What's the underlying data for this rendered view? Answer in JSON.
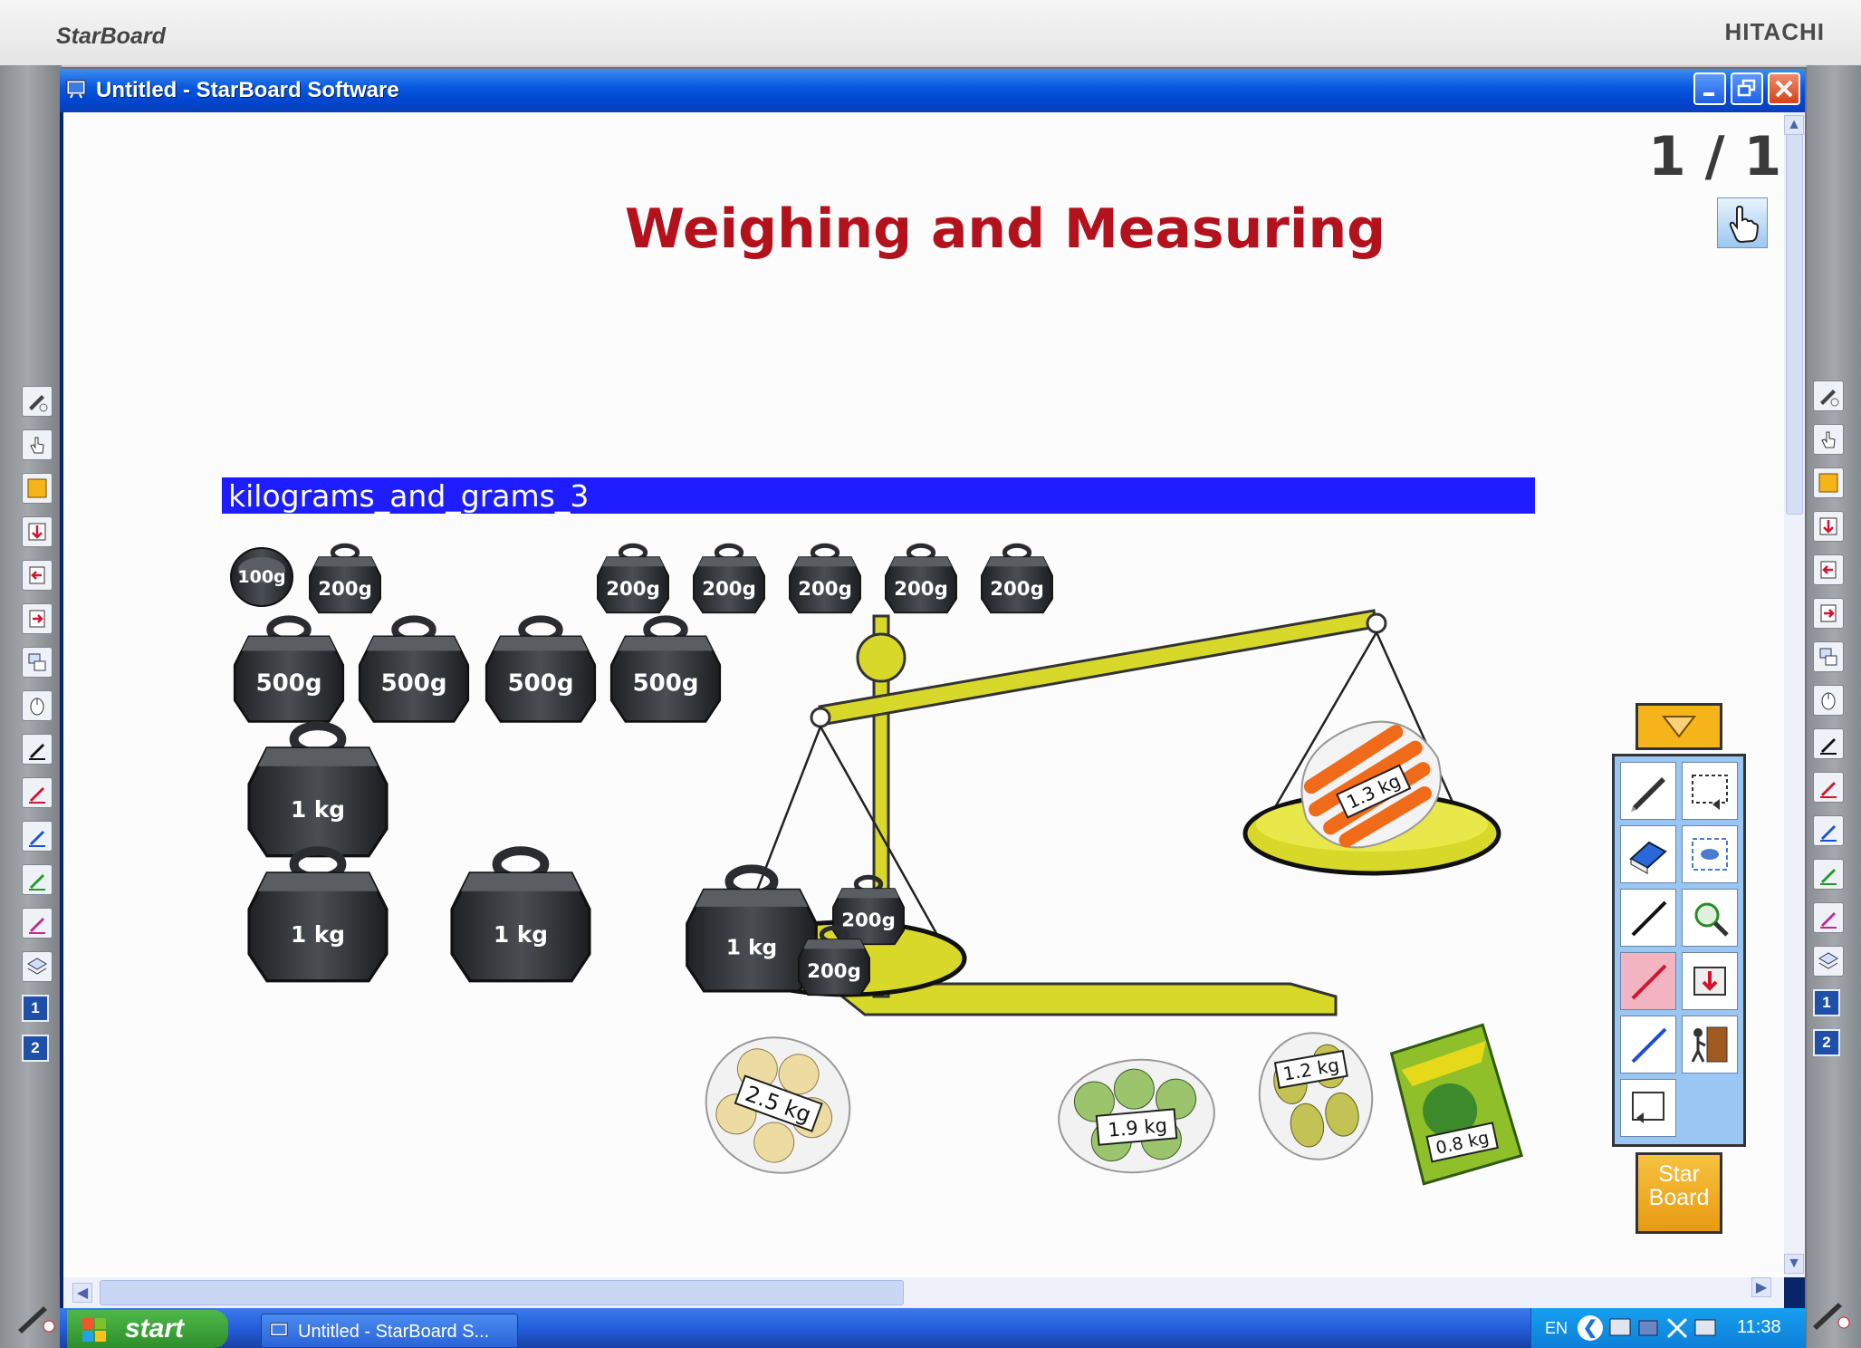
{
  "bezel": {
    "brand": "StarBoard",
    "maker": "HITACHI"
  },
  "window": {
    "title": "Untitled - StarBoard Software"
  },
  "page": {
    "indicator": "1 / 1"
  },
  "slide": {
    "title": "Weighing and Measuring",
    "flash_title": "kilograms_and_grams_3"
  },
  "weights": {
    "loose": [
      "100g",
      "200g",
      "200g",
      "200g",
      "200g",
      "200g",
      "200g",
      "500g",
      "500g",
      "500g",
      "500g",
      "1 kg",
      "1 kg",
      "1 kg"
    ],
    "on_scale": [
      "1 kg",
      "200g",
      "200g"
    ]
  },
  "produce": {
    "on_scale": "1.3 kg",
    "items": [
      "2.5 kg",
      "1.9 kg",
      "1.2 kg",
      "0.8 kg"
    ]
  },
  "toolbar": {
    "logo_line1": "Star",
    "logo_line2": "Board"
  },
  "side_toolbar": {
    "page1": "1",
    "page2": "2"
  },
  "taskbar": {
    "start": "start",
    "task": "Untitled - StarBoard S...",
    "lang": "EN",
    "clock": "11:38"
  },
  "colors": {
    "title_red": "#b3111c",
    "flash_bar": "#1d1dff",
    "scale_yellow": "#d8d82a",
    "weight_dark": "#2f3236",
    "xp_blue": "#0a5be0",
    "toolbar_orange": "#f5b51a"
  },
  "icons": {
    "side": [
      "pen-mode-icon",
      "mouse-mode-icon",
      "starboard-app-icon",
      "import-icon",
      "previous-page-icon",
      "next-page-icon",
      "page-list-icon",
      "pointer-icon",
      "pen-black-icon",
      "pen-red-icon",
      "pen-blue-icon",
      "pen-green-icon",
      "pen-magenta-icon",
      "layers-icon"
    ],
    "float": [
      "pen-icon",
      "screen-capture-icon",
      "eraser-icon",
      "spotlight-icon",
      "line-black-icon",
      "magnifier-icon",
      "line-red-icon",
      "import-page-icon",
      "line-blue-icon",
      "exit-door-icon",
      "back-icon"
    ]
  }
}
